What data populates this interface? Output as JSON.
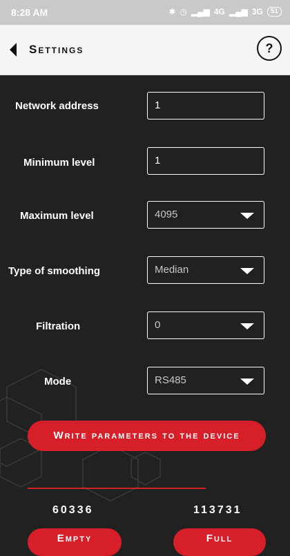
{
  "status_bar": {
    "time": "8:28 AM",
    "network": "4G",
    "network2": "3G",
    "battery": "51"
  },
  "app_bar": {
    "title": "Settings",
    "help_glyph": "?"
  },
  "settings": {
    "network_address": {
      "label": "Network address",
      "value": "1"
    },
    "minimum_level": {
      "label": "Minimum level",
      "value": "1"
    },
    "maximum_level": {
      "label": "Maximum level",
      "value": "4095"
    },
    "type_of_smoothing": {
      "label": "Type of smoothing",
      "value": "Median"
    },
    "filtration": {
      "label": "Filtration",
      "value": "0"
    },
    "mode": {
      "label": "Mode",
      "value": "RS485"
    }
  },
  "actions": {
    "write_label": "Write parameters to the device",
    "empty_label": "Empty",
    "full_label": "Full"
  },
  "readings": {
    "empty_value": "60336",
    "full_value": "113731"
  },
  "colors": {
    "accent": "#d61f28",
    "background": "#212121",
    "appbar": "#f5f5f5"
  }
}
